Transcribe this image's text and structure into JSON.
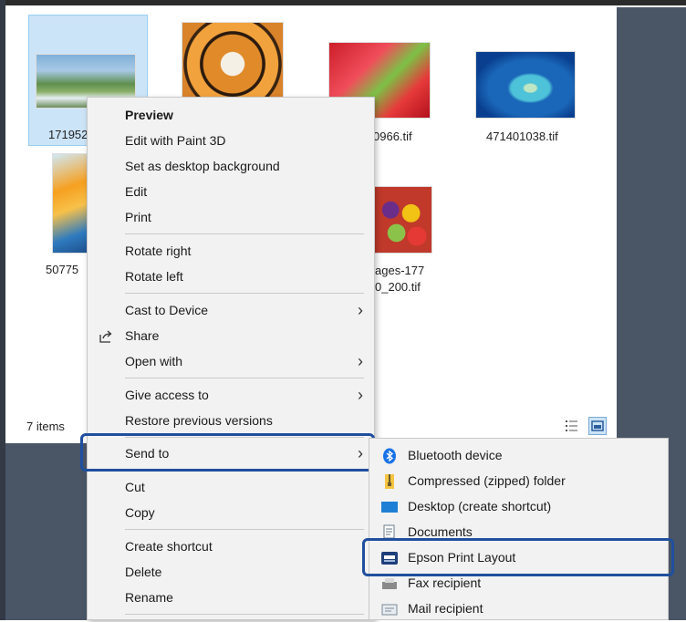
{
  "files": [
    {
      "name": "171952",
      "image": "waterfall-photo"
    },
    {
      "name": "",
      "image": "tiger-photo"
    },
    {
      "name": "0966.tif",
      "image": "juice-photo"
    },
    {
      "name": "471401038.tif",
      "image": "island-photo"
    },
    {
      "name": "50775",
      "image": "juice-glass-photo"
    },
    {
      "name_line1": "ages-177",
      "name_line2": "0_200.tif",
      "image": "fruits-photo"
    }
  ],
  "status": {
    "items_count": "7 items"
  },
  "context_menu": {
    "items": [
      {
        "label": "Preview",
        "bold": true
      },
      {
        "label": "Edit with Paint 3D"
      },
      {
        "label": "Set as desktop background"
      },
      {
        "label": "Edit"
      },
      {
        "label": "Print"
      },
      {
        "label": "Rotate right"
      },
      {
        "label": "Rotate left"
      },
      {
        "label": "Cast to Device",
        "submenu": true
      },
      {
        "label": "Share",
        "icon": "share-icon"
      },
      {
        "label": "Open with",
        "submenu": true
      },
      {
        "label": "Give access to",
        "submenu": true
      },
      {
        "label": "Restore previous versions"
      },
      {
        "label": "Send to",
        "submenu": true,
        "highlighted": true
      },
      {
        "label": "Cut"
      },
      {
        "label": "Copy"
      },
      {
        "label": "Create shortcut"
      },
      {
        "label": "Delete"
      },
      {
        "label": "Rename"
      }
    ],
    "arrow_glyph": "›"
  },
  "send_to_menu": {
    "items": [
      {
        "label": "Bluetooth device",
        "icon": "bluetooth-icon"
      },
      {
        "label": "Compressed (zipped) folder",
        "icon": "zip-folder-icon"
      },
      {
        "label": "Desktop (create shortcut)",
        "icon": "desktop-icon"
      },
      {
        "label": "Documents",
        "icon": "documents-icon"
      },
      {
        "label": "Epson Print Layout",
        "icon": "printer-app-icon",
        "highlighted": true
      },
      {
        "label": "Fax recipient",
        "icon": "fax-icon"
      },
      {
        "label": "Mail recipient",
        "icon": "mail-icon"
      }
    ]
  },
  "colors": {
    "highlight_border": "#1f4f9e",
    "selection": "#cce4f7",
    "menu_bg": "#f2f2f2"
  }
}
